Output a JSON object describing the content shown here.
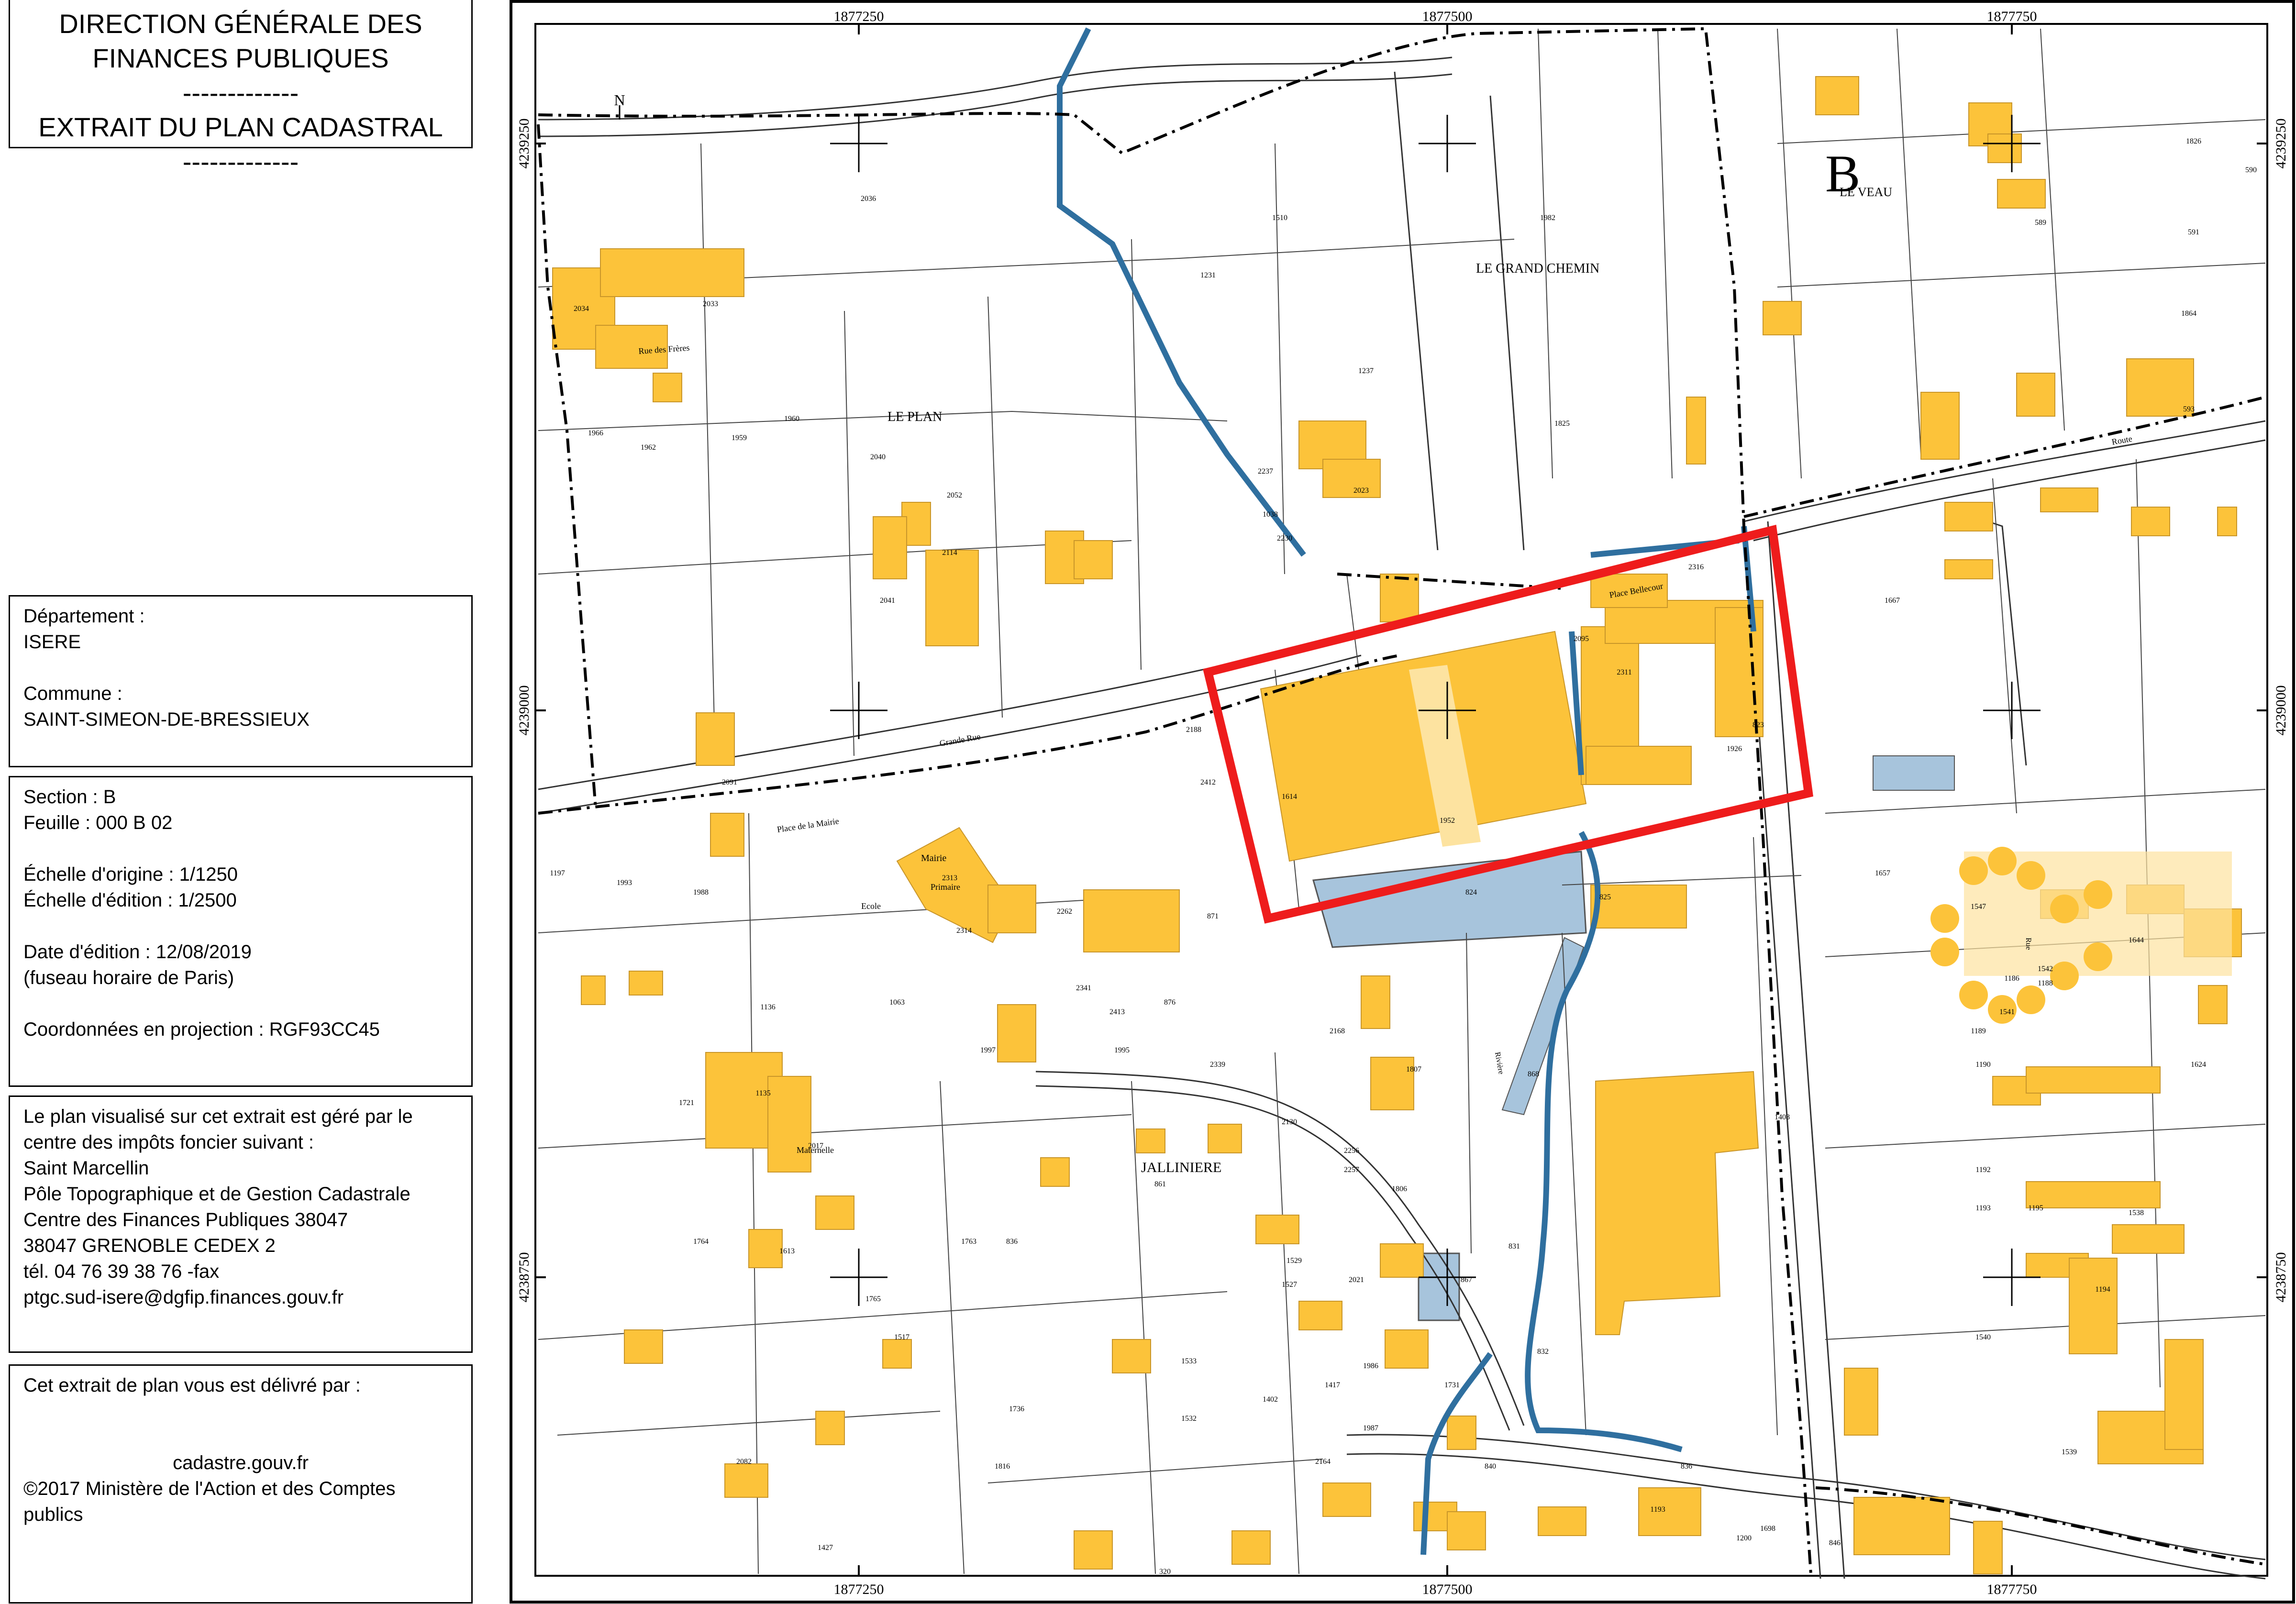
{
  "header": {
    "line1": "DIRECTION GÉNÉRALE DES",
    "line2": "FINANCES PUBLIQUES",
    "sep1": "-------------",
    "line3": "EXTRAIT DU PLAN CADASTRAL",
    "sep2": "-------------"
  },
  "location": {
    "departement_label": "Département :",
    "departement": "ISERE",
    "commune_label": "Commune :",
    "commune": "SAINT-SIMEON-DE-BRESSIEUX"
  },
  "sheet": {
    "section": "Section : B",
    "feuille": "Feuille : 000 B 02",
    "echelle_origine": "Échelle d'origine : 1/1250",
    "echelle_edition": "Échelle d'édition : 1/2500",
    "date_edition": "Date d'édition : 12/08/2019",
    "fuseau": "(fuseau horaire de Paris)",
    "projection": "Coordonnées en projection : RGF93CC45"
  },
  "office": {
    "l1": "Le plan visualisé sur cet extrait est géré par le",
    "l2": "centre des impôts foncier suivant :",
    "l3": "Saint Marcellin",
    "l4": "Pôle Topographique et de Gestion Cadastrale",
    "l5": "Centre des Finances Publiques 38047",
    "l6": "38047 GRENOBLE CEDEX 2",
    "l7": "tél. 04 76 39 38 76 -fax",
    "l8": "ptgc.sud-isere@dgfip.finances.gouv.fr"
  },
  "delivery": {
    "l1": "Cet extrait de plan vous est délivré par :",
    "l2": "cadastre.gouv.fr",
    "l3": "©2017 Ministère de l'Action et des Comptes",
    "l4": "publics"
  },
  "map": {
    "x_coords": [
      "1877250",
      "1877500",
      "1877750"
    ],
    "y_coords": [
      "4239250",
      "4239000",
      "4238750"
    ],
    "north": "N",
    "section_letter": "B",
    "places": {
      "le_veau": "LE VEAU",
      "le_grand_chemin": "LE GRAND CHEMIN",
      "le_plan": "LE PLAN",
      "jalliniere": "JALLINIERE",
      "place_bellecour": "Place Bellecour",
      "mairie": "Mairie",
      "ecole": "Ecole",
      "ecole_primaire": "Primaire",
      "ecole_mat": "Maternelle"
    },
    "parcels": [
      {
        "n": "2311"
      },
      {
        "n": "2095"
      },
      {
        "n": "2316"
      },
      {
        "n": "1926"
      },
      {
        "n": "823"
      },
      {
        "n": "1952"
      },
      {
        "n": "824"
      },
      {
        "n": "825"
      },
      {
        "n": "868"
      },
      {
        "n": "831"
      },
      {
        "n": "832"
      },
      {
        "n": "867"
      },
      {
        "n": "1408"
      },
      {
        "n": "1657"
      },
      {
        "n": "1547"
      },
      {
        "n": "1644"
      },
      {
        "n": "1538"
      },
      {
        "n": "1539"
      },
      {
        "n": "1540"
      },
      {
        "n": "1190"
      },
      {
        "n": "1192"
      },
      {
        "n": "1193"
      },
      {
        "n": "1189"
      },
      {
        "n": "1186"
      },
      {
        "n": "1667"
      },
      {
        "n": "1825"
      },
      {
        "n": "1982"
      },
      {
        "n": "1510"
      },
      {
        "n": "1231"
      },
      {
        "n": "2036"
      },
      {
        "n": "2033"
      },
      {
        "n": "2034"
      },
      {
        "n": "1966"
      },
      {
        "n": "1962"
      },
      {
        "n": "1959"
      },
      {
        "n": "1960"
      },
      {
        "n": "2040"
      },
      {
        "n": "2052"
      },
      {
        "n": "2114"
      },
      {
        "n": "2041"
      },
      {
        "n": "2091"
      },
      {
        "n": "2017"
      },
      {
        "n": "1763"
      },
      {
        "n": "836"
      },
      {
        "n": "861"
      },
      {
        "n": "1533"
      },
      {
        "n": "1532"
      },
      {
        "n": "1736"
      },
      {
        "n": "1816"
      },
      {
        "n": "2164"
      },
      {
        "n": "1987"
      },
      {
        "n": "1986"
      },
      {
        "n": "2168"
      },
      {
        "n": "1807"
      },
      {
        "n": "2262"
      },
      {
        "n": "2313"
      },
      {
        "n": "2314"
      },
      {
        "n": "871"
      },
      {
        "n": "876"
      },
      {
        "n": "2341"
      },
      {
        "n": "1529"
      },
      {
        "n": "1527"
      },
      {
        "n": "1806"
      },
      {
        "n": "2256"
      },
      {
        "n": "2257"
      },
      {
        "n": "2021"
      },
      {
        "n": "1624"
      },
      {
        "n": "1541"
      },
      {
        "n": "1542"
      },
      {
        "n": "1188"
      },
      {
        "n": "1195"
      },
      {
        "n": "1194"
      },
      {
        "n": "1864"
      },
      {
        "n": "1826"
      },
      {
        "n": "591"
      },
      {
        "n": "590"
      },
      {
        "n": "589"
      },
      {
        "n": "593"
      },
      {
        "n": "1237"
      },
      {
        "n": "2023"
      },
      {
        "n": "1038"
      },
      {
        "n": "2237"
      },
      {
        "n": "2230"
      },
      {
        "n": "1197"
      },
      {
        "n": "1993"
      },
      {
        "n": "1988"
      },
      {
        "n": "1136"
      },
      {
        "n": "1721"
      },
      {
        "n": "1135"
      },
      {
        "n": "1063"
      },
      {
        "n": "1997"
      },
      {
        "n": "1995"
      },
      {
        "n": "2339"
      },
      {
        "n": "2130"
      },
      {
        "n": "1402"
      },
      {
        "n": "1417"
      },
      {
        "n": "1731"
      },
      {
        "n": "840"
      },
      {
        "n": "836"
      },
      {
        "n": "1193"
      },
      {
        "n": "1200"
      },
      {
        "n": "846"
      },
      {
        "n": "320"
      },
      {
        "n": "1427"
      },
      {
        "n": "2082"
      },
      {
        "n": "1517"
      },
      {
        "n": "1765"
      },
      {
        "n": "1764"
      },
      {
        "n": "1613"
      },
      {
        "n": "1614"
      },
      {
        "n": "2188"
      },
      {
        "n": "2412"
      },
      {
        "n": "2413"
      },
      {
        "n": "1698"
      }
    ],
    "streets": {
      "rue_des_freres": "Rue des Frères",
      "grande_rue": "Grande Rue",
      "place_de_la_mairie": "Place de la Mairie",
      "route": "Route",
      "riviere": "Rivière",
      "rue": "Rue"
    },
    "colors": {
      "building": "#fcc33a",
      "building_light": "#fde3a0",
      "water": "#a7c4dc",
      "stream": "#2f6f9f",
      "highlight": "#ee1c1c"
    }
  }
}
